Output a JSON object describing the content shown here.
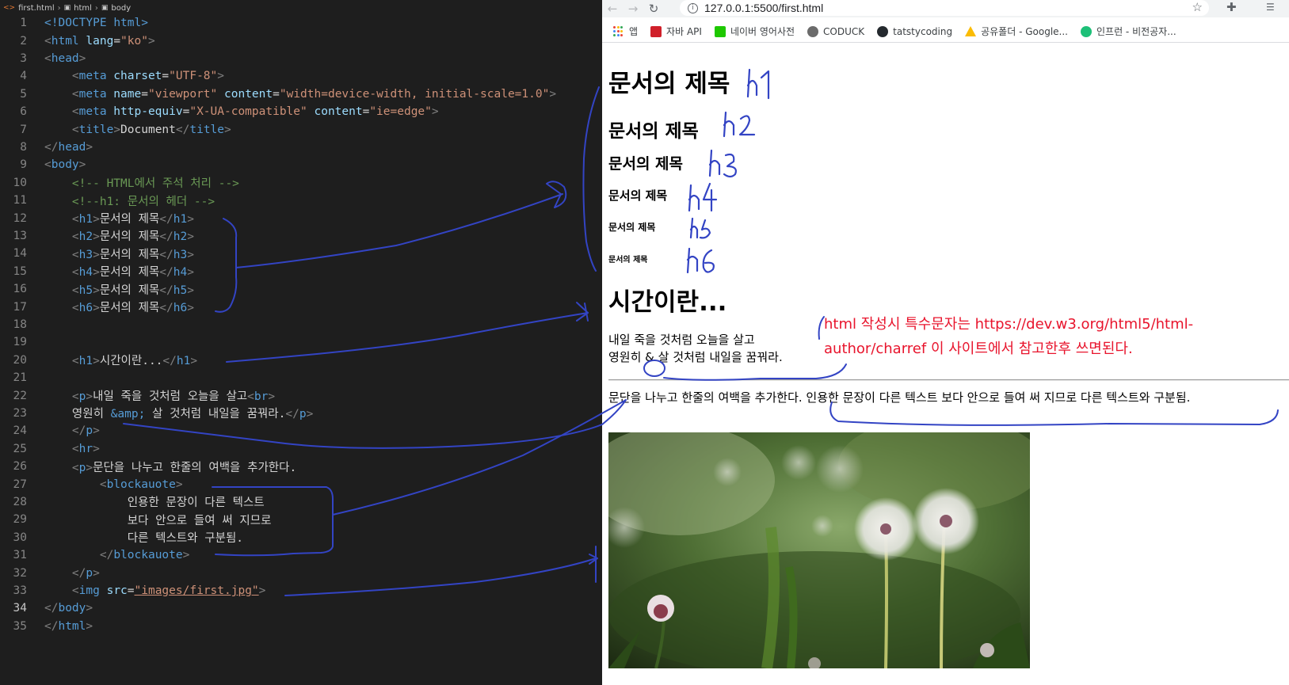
{
  "editor": {
    "breadcrumb": [
      "first.html",
      "html",
      "body"
    ],
    "lines": [
      [
        [
          "<!DOCTYPE ",
          "tag"
        ],
        [
          "html",
          "tag"
        ],
        [
          ">",
          "tag"
        ]
      ],
      [
        [
          "<",
          "punc"
        ],
        [
          "html",
          "tag"
        ],
        [
          " lang",
          "attr"
        ],
        [
          "=",
          "txt"
        ],
        [
          "\"ko\"",
          "str"
        ],
        [
          ">",
          "punc"
        ]
      ],
      [
        [
          "<",
          "punc"
        ],
        [
          "head",
          "tag"
        ],
        [
          ">",
          "punc"
        ]
      ],
      [
        [
          "    ",
          "txt"
        ],
        [
          "<",
          "punc"
        ],
        [
          "meta",
          "tag"
        ],
        [
          " charset",
          "attr"
        ],
        [
          "=",
          "txt"
        ],
        [
          "\"UTF-8\"",
          "str"
        ],
        [
          ">",
          "punc"
        ]
      ],
      [
        [
          "    ",
          "txt"
        ],
        [
          "<",
          "punc"
        ],
        [
          "meta",
          "tag"
        ],
        [
          " name",
          "attr"
        ],
        [
          "=",
          "txt"
        ],
        [
          "\"viewport\"",
          "str"
        ],
        [
          " content",
          "attr"
        ],
        [
          "=",
          "txt"
        ],
        [
          "\"width=device-width, initial-scale=1.0\"",
          "str"
        ],
        [
          ">",
          "punc"
        ]
      ],
      [
        [
          "    ",
          "txt"
        ],
        [
          "<",
          "punc"
        ],
        [
          "meta",
          "tag"
        ],
        [
          " http-equiv",
          "attr"
        ],
        [
          "=",
          "txt"
        ],
        [
          "\"X-UA-compatible\"",
          "str"
        ],
        [
          " content",
          "attr"
        ],
        [
          "=",
          "txt"
        ],
        [
          "\"ie=edge\"",
          "str"
        ],
        [
          ">",
          "punc"
        ]
      ],
      [
        [
          "    ",
          "txt"
        ],
        [
          "<",
          "punc"
        ],
        [
          "title",
          "tag"
        ],
        [
          ">",
          "punc"
        ],
        [
          "Document",
          "txt"
        ],
        [
          "</",
          "punc"
        ],
        [
          "title",
          "tag"
        ],
        [
          ">",
          "punc"
        ]
      ],
      [
        [
          "</",
          "punc"
        ],
        [
          "head",
          "tag"
        ],
        [
          ">",
          "punc"
        ]
      ],
      [
        [
          "<",
          "punc"
        ],
        [
          "body",
          "tag"
        ],
        [
          ">",
          "punc"
        ]
      ],
      [
        [
          "    ",
          "txt"
        ],
        [
          "<!-- HTML에서 주석 처리 -->",
          "com"
        ]
      ],
      [
        [
          "    ",
          "txt"
        ],
        [
          "<!--h1: 문서의 헤더 -->",
          "com"
        ]
      ],
      [
        [
          "    ",
          "txt"
        ],
        [
          "<",
          "punc"
        ],
        [
          "h1",
          "tag"
        ],
        [
          ">",
          "punc"
        ],
        [
          "문서의 제목",
          "txt"
        ],
        [
          "</",
          "punc"
        ],
        [
          "h1",
          "tag"
        ],
        [
          ">",
          "punc"
        ]
      ],
      [
        [
          "    ",
          "txt"
        ],
        [
          "<",
          "punc"
        ],
        [
          "h2",
          "tag"
        ],
        [
          ">",
          "punc"
        ],
        [
          "문서의 제목",
          "txt"
        ],
        [
          "</",
          "punc"
        ],
        [
          "h2",
          "tag"
        ],
        [
          ">",
          "punc"
        ]
      ],
      [
        [
          "    ",
          "txt"
        ],
        [
          "<",
          "punc"
        ],
        [
          "h3",
          "tag"
        ],
        [
          ">",
          "punc"
        ],
        [
          "문서의 제목",
          "txt"
        ],
        [
          "</",
          "punc"
        ],
        [
          "h3",
          "tag"
        ],
        [
          ">",
          "punc"
        ]
      ],
      [
        [
          "    ",
          "txt"
        ],
        [
          "<",
          "punc"
        ],
        [
          "h4",
          "tag"
        ],
        [
          ">",
          "punc"
        ],
        [
          "문서의 제목",
          "txt"
        ],
        [
          "</",
          "punc"
        ],
        [
          "h4",
          "tag"
        ],
        [
          ">",
          "punc"
        ]
      ],
      [
        [
          "    ",
          "txt"
        ],
        [
          "<",
          "punc"
        ],
        [
          "h5",
          "tag"
        ],
        [
          ">",
          "punc"
        ],
        [
          "문서의 제목",
          "txt"
        ],
        [
          "</",
          "punc"
        ],
        [
          "h5",
          "tag"
        ],
        [
          ">",
          "punc"
        ]
      ],
      [
        [
          "    ",
          "txt"
        ],
        [
          "<",
          "punc"
        ],
        [
          "h6",
          "tag"
        ],
        [
          ">",
          "punc"
        ],
        [
          "문서의 제목",
          "txt"
        ],
        [
          "</",
          "punc"
        ],
        [
          "h6",
          "tag"
        ],
        [
          ">",
          "punc"
        ]
      ],
      [],
      [],
      [
        [
          "    ",
          "txt"
        ],
        [
          "<",
          "punc"
        ],
        [
          "h1",
          "tag"
        ],
        [
          ">",
          "punc"
        ],
        [
          "시간이란...",
          "txt"
        ],
        [
          "</",
          "punc"
        ],
        [
          "h1",
          "tag"
        ],
        [
          ">",
          "punc"
        ]
      ],
      [],
      [
        [
          "    ",
          "txt"
        ],
        [
          "<",
          "punc"
        ],
        [
          "p",
          "tag"
        ],
        [
          ">",
          "punc"
        ],
        [
          "내일 죽을 것처럼 오늘을 살고",
          "txt"
        ],
        [
          "<",
          "punc"
        ],
        [
          "br",
          "tag"
        ],
        [
          ">",
          "punc"
        ]
      ],
      [
        [
          "    ",
          "txt"
        ],
        [
          "영원히 ",
          "txt"
        ],
        [
          "&amp;",
          "ent"
        ],
        [
          " 살 것처럼 내일을 꿈꿔라.",
          "txt"
        ],
        [
          "</",
          "punc"
        ],
        [
          "p",
          "tag"
        ],
        [
          ">",
          "punc"
        ]
      ],
      [
        [
          "    ",
          "txt"
        ],
        [
          "</",
          "punc"
        ],
        [
          "p",
          "tag"
        ],
        [
          ">",
          "punc"
        ]
      ],
      [
        [
          "    ",
          "txt"
        ],
        [
          "<",
          "punc"
        ],
        [
          "hr",
          "tag"
        ],
        [
          ">",
          "punc"
        ]
      ],
      [
        [
          "    ",
          "txt"
        ],
        [
          "<",
          "punc"
        ],
        [
          "p",
          "tag"
        ],
        [
          ">",
          "punc"
        ],
        [
          "문단을 나누고 한줄의 여백을 추가한다.",
          "txt"
        ]
      ],
      [
        [
          "        ",
          "txt"
        ],
        [
          "<",
          "punc"
        ],
        [
          "blockauote",
          "tag"
        ],
        [
          ">",
          "punc"
        ]
      ],
      [
        [
          "            ",
          "txt"
        ],
        [
          "인용한 문장이 다른 텍스트",
          "txt"
        ]
      ],
      [
        [
          "            ",
          "txt"
        ],
        [
          "보다 안으로 들여 써 지므로",
          "txt"
        ]
      ],
      [
        [
          "            ",
          "txt"
        ],
        [
          "다른 텍스트와 구분됨.",
          "txt"
        ]
      ],
      [
        [
          "        ",
          "txt"
        ],
        [
          "</",
          "punc"
        ],
        [
          "blockauote",
          "tag"
        ],
        [
          ">",
          "punc"
        ]
      ],
      [
        [
          "    ",
          "txt"
        ],
        [
          "</",
          "punc"
        ],
        [
          "p",
          "tag"
        ],
        [
          ">",
          "punc"
        ]
      ],
      [
        [
          "    ",
          "txt"
        ],
        [
          "<",
          "punc"
        ],
        [
          "img",
          "tag"
        ],
        [
          " src",
          "attr"
        ],
        [
          "=",
          "txt"
        ],
        [
          "\"images/first.jpg\"",
          "str"
        ],
        [
          ">",
          "punc"
        ]
      ],
      [
        [
          "</",
          "punc"
        ],
        [
          "body",
          "tag"
        ],
        [
          ">",
          "punc"
        ]
      ],
      [
        [
          "</",
          "punc"
        ],
        [
          "html",
          "tag"
        ],
        [
          ">",
          "punc"
        ]
      ]
    ]
  },
  "browser": {
    "url": "127.0.0.1:5500/first.html",
    "bookmarks": [
      {
        "label": "앱",
        "icon": "apps-grid-icon",
        "color": "#4285f4"
      },
      {
        "label": "자바 API",
        "icon": "oracle-icon",
        "color": "#d0202a"
      },
      {
        "label": "네이버 영어사전",
        "icon": "naver-dict-icon",
        "color": "#1ec800"
      },
      {
        "label": "CODUCK",
        "icon": "coduck-icon",
        "color": "#6b6b6b"
      },
      {
        "label": "tatstycoding",
        "icon": "github-icon",
        "color": "#24292e"
      },
      {
        "label": "공유폴더 - Google...",
        "icon": "google-drive-icon",
        "color": "#fbbc04"
      },
      {
        "label": "인프런 - 비전공자...",
        "icon": "inflearn-icon",
        "color": "#1dc078"
      }
    ],
    "page": {
      "h1": "문서의 제목",
      "h2": "문서의 제목",
      "h3": "문서의 제목",
      "h4": "문서의 제목",
      "h5": "문서의 제목",
      "h6": "문서의 제목",
      "title": "시간이란...",
      "para_line1": "내일 죽을 것처럼 오늘을 살고",
      "para_line2": "영원히 & 살 것처럼 내일을 꿈꿔라.",
      "para2": "문단을 나누고 한줄의 여백을 추가한다. 인용한 문장이 다른 텍스트 보다 안으로 들여 써 지므로 다른 텍스트와 구분됨.",
      "image_alt": "dandelion photo"
    }
  },
  "annotations": {
    "handwritten_labels": [
      "h1",
      "h2",
      "h3",
      "h4",
      "h5",
      "h6"
    ],
    "note_line1": "html 작성시 특수문자는 https://dev.w3.org/html5/html-",
    "note_line2": "author/charref 이 사이트에서 참고한후 쓰면된다.",
    "ink_color": "#3344c4",
    "note_color": "#e8142c"
  }
}
